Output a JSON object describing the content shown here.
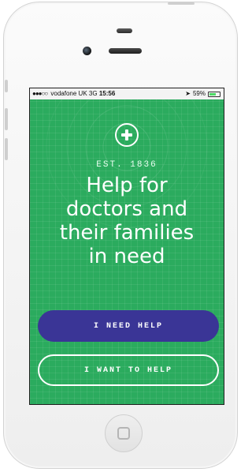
{
  "status_bar": {
    "signal": "●●●○○",
    "carrier": "vodafone UK",
    "network": "3G",
    "time": "15:56",
    "battery_percent": "59%",
    "location_icon": "location-arrow-icon",
    "battery_icon": "battery-icon"
  },
  "app": {
    "logo_icon": "plus-circle-icon",
    "established": "EST. 1836",
    "headline_lines": [
      "Help for",
      "doctors and",
      "their families",
      "in need"
    ],
    "primary_button": "I NEED HELP",
    "secondary_button": "I WANT TO HELP"
  },
  "colors": {
    "background": "#2bab5e",
    "primary_button": "#3a3596",
    "text": "#ffffff"
  }
}
